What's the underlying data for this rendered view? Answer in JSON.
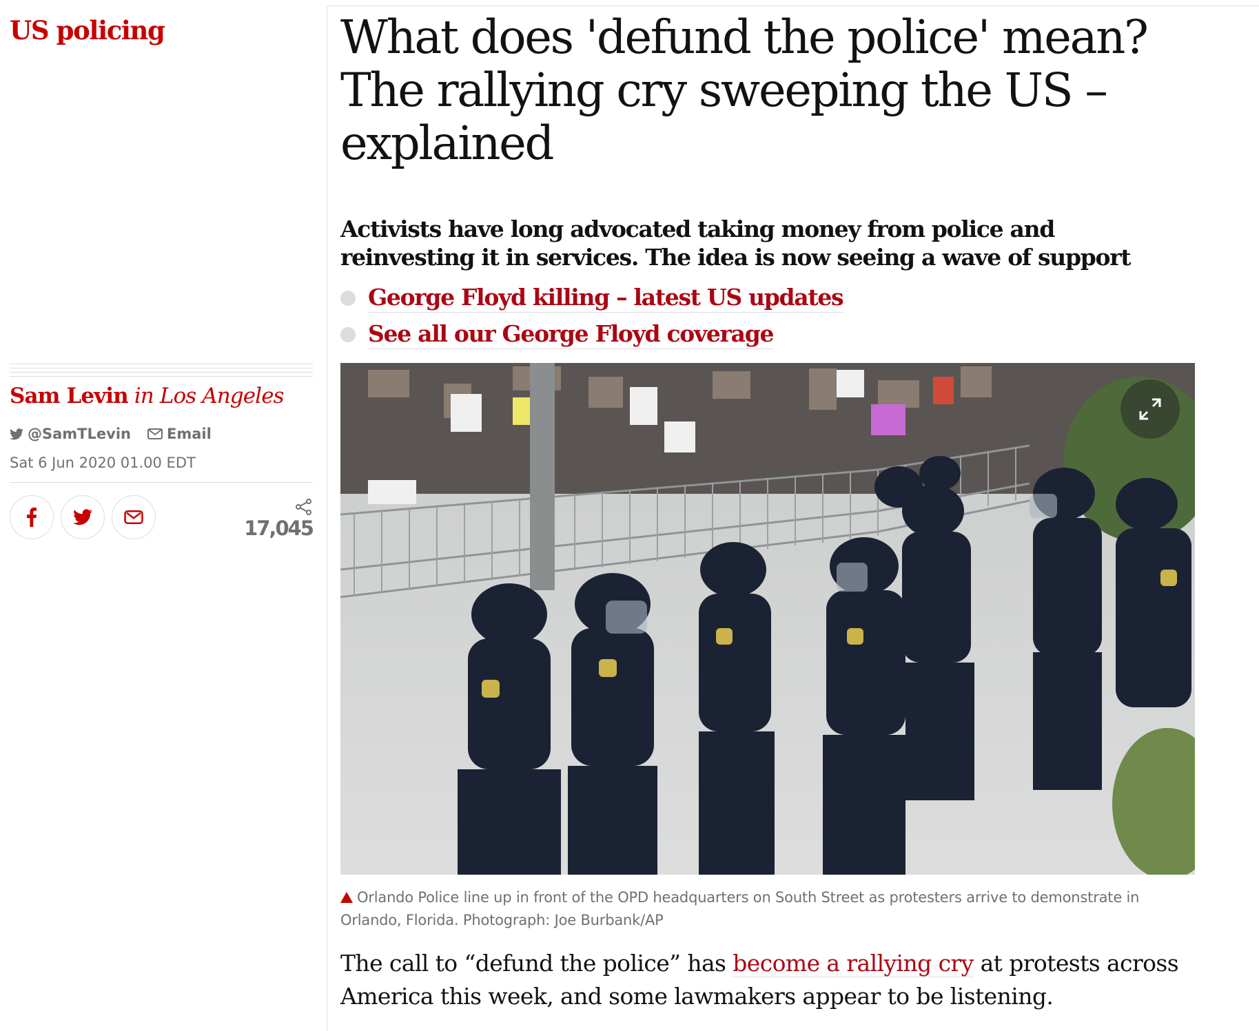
{
  "section": {
    "label": "US policing"
  },
  "article": {
    "headline": "What does 'defund the police' mean? The rallying cry sweeping the US – explained",
    "standfirst": "Activists have long advocated taking money from police and reinvesting it in services. The idea is now seeing a wave of support",
    "related_links": [
      {
        "label": "George Floyd killing – latest US updates"
      },
      {
        "label": "See all our George Floyd coverage"
      }
    ],
    "image": {
      "caption": "Orlando Police line up in front of the OPD headquarters on South Street as protesters arrive to demonstrate in Orlando, Florida. Photograph: Joe Burbank/AP",
      "expand_icon": "expand-icon"
    },
    "body": {
      "before_link": "The call to “defund the police” has ",
      "link_text": "become a rallying cry",
      "after_link": " at protests across America this week, and some lawmakers appear to be listening."
    }
  },
  "byline": {
    "author": "Sam Levin",
    "location": "in Los Angeles",
    "twitter_handle": "@SamTLevin",
    "email_label": "Email",
    "date": "Sat 6 Jun 2020 01.00 EDT"
  },
  "share": {
    "buttons": [
      {
        "name": "facebook",
        "icon": "facebook-icon"
      },
      {
        "name": "twitter",
        "icon": "twitter-icon"
      },
      {
        "name": "email",
        "icon": "email-icon"
      }
    ],
    "count": "17,045"
  },
  "colors": {
    "accent_red": "#c70000",
    "link_red": "#ab0613",
    "muted_grey": "#707070",
    "rule_grey": "#dcdcdc"
  }
}
